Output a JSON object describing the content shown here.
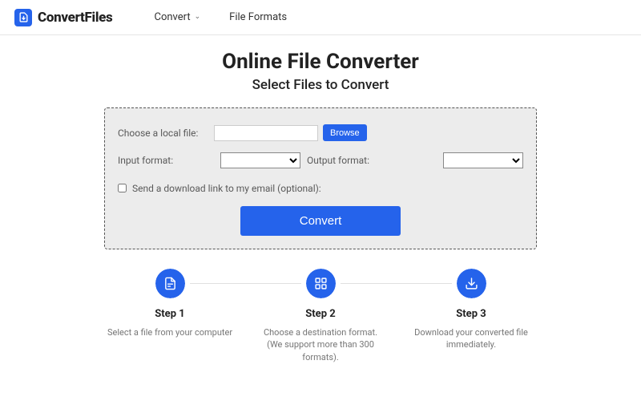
{
  "header": {
    "brand": "ConvertFiles",
    "nav": {
      "convert": "Convert",
      "formats": "File Formats"
    }
  },
  "hero": {
    "title": "Online File Converter",
    "subtitle": "Select Files to Convert"
  },
  "panel": {
    "choose_label": "Choose a local file:",
    "browse": "Browse",
    "input_format_label": "Input format:",
    "output_format_label": "Output format:",
    "email_label": "Send a download link to my email (optional):",
    "convert": "Convert"
  },
  "steps": [
    {
      "title": "Step 1",
      "desc": "Select a file from your computer"
    },
    {
      "title": "Step 2",
      "desc": "Choose a destination format. (We support more than 300 formats)."
    },
    {
      "title": "Step 3",
      "desc": "Download your converted file immediately."
    }
  ]
}
